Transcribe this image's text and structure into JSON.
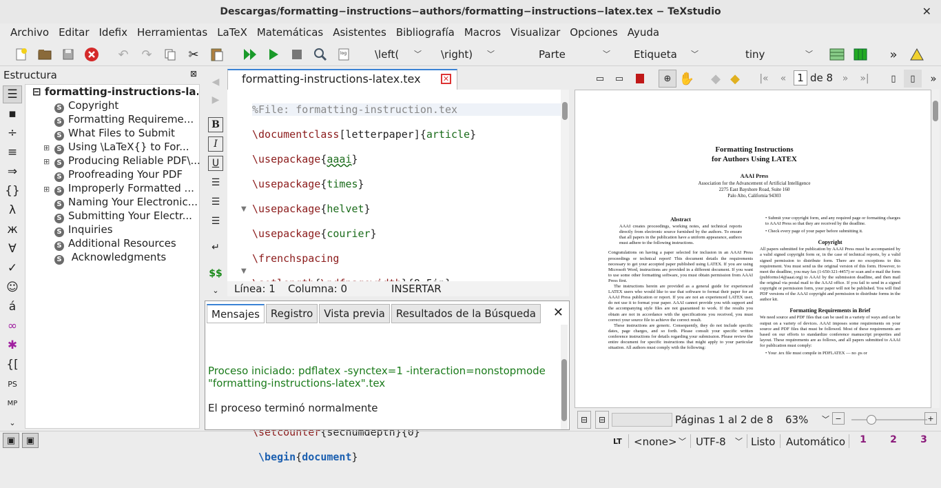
{
  "window": {
    "title": "Descargas/formatting−instructions−authors/formatting−instructions−latex.tex − TeXstudio",
    "close": "✕"
  },
  "menu": [
    "Archivo",
    "Editar",
    "Idefix",
    "Herramientas",
    "LaTeX",
    "Matemáticas",
    "Asistentes",
    "Bibliografía",
    "Macros",
    "Visualizar",
    "Opciones",
    "Ayuda"
  ],
  "toolbar": {
    "left_combo": "\\left(",
    "right_combo": "\\right)",
    "parte": "Parte",
    "etiqueta": "Etiqueta",
    "size": "tiny",
    "more": "»"
  },
  "structure": {
    "title": "Estructura",
    "root": "formatting-instructions-la...",
    "items": [
      {
        "label": "Copyright",
        "expandable": false
      },
      {
        "label": "Formatting Requireme...",
        "expandable": false
      },
      {
        "label": "What Files to Submit",
        "expandable": false
      },
      {
        "label": "Using \\LaTeX{} to For...",
        "expandable": true
      },
      {
        "label": "Producing Reliable PDF\\...",
        "expandable": true
      },
      {
        "label": "Proofreading Your PDF",
        "expandable": false
      },
      {
        "label": "Improperly Formatted ...",
        "expandable": true
      },
      {
        "label": "Naming Your Electronic...",
        "expandable": false
      },
      {
        "label": "Submitting Your Electr...",
        "expandable": false
      },
      {
        "label": "Inquiries",
        "expandable": false
      },
      {
        "label": "Additional Resources",
        "expandable": false
      },
      {
        "label": " Acknowledgments",
        "expandable": false
      }
    ]
  },
  "editor": {
    "tab": "formatting-instructions-latex.tex",
    "status": {
      "line": "Línea: 1",
      "col": "Columna: 0",
      "mode": "INSERTAR"
    }
  },
  "messages": {
    "tabs": [
      "Mensajes",
      "Registro",
      "Vista previa",
      "Resultados de la Búsqueda"
    ],
    "line1": "Proceso iniciado: pdflatex -synctex=1 -interaction=nonstopmode",
    "line2": "\"formatting-instructions-latex\".tex",
    "line3": "El proceso terminó normalmente"
  },
  "pdf": {
    "page_input": "1",
    "of": "de 8",
    "pages_label": "Páginas 1 al 2 de 8",
    "zoom": "63%",
    "title1": "Formatting Instructions",
    "title2": "for Authors Using LATEX",
    "press": "AAAI Press",
    "assoc": "Association for the Advancement of Artificial Intelligence",
    "addr1": "2275 East Bayshore Road, Suite 160",
    "addr2": "Palo Alto, California 94303",
    "abstract_h": "Abstract",
    "abstract": "AAAI creates proceedings, working notes, and technical reports directly from electronic source furnished by the authors. To ensure that all papers in the publication have a uniform appearance, authors must adhere to the following instructions.",
    "left1": "Congratulations on having a paper selected for inclusion in an AAAI Press proceedings or technical report! This document details the requirements necessary to get your accepted paper published using LATEX. If you are using Microsoft Word, instructions are provided in a different document. If you want to use some other formatting software, you must obtain permission from AAAI Press first.",
    "left2": "The instructions herein are provided as a general guide for experienced LATEX users who would like to use that software to format their paper for an AAAI Press publication or report. If you are not an experienced LATEX user, do not use it to format your paper. AAAI cannot provide you with support and the accompanying style files are not guaranteed to work. If the results you obtain are not in accordance with the specifications you received, you must correct your source file to achieve the correct result.",
    "left3": "These instructions are generic. Consequently, they do not include specific dates, page charges, and so forth. Please consult your specific written conference instructions for details regarding your submission. Please review the entire document for specific instructions that might apply to your particular situation. All authors must comply with the following:",
    "bullet1": "Submit your copyright form, and any required page or formatting charges to AAAI Press so that they are received by the deadline.",
    "bullet2": "Check every page of your paper before submitting it.",
    "copyright_h": "Copyright",
    "copyright": "All papers submitted for publication by AAAI Press must be accompanied by a valid signed copyright form or, in the case of technical reports, by a valid signed permission to distribute form. There are no exceptions to this requirement. You must send us the original version of this form. However, to meet the deadline, you may fax (1-650-321-4457) or scan and e-mail the form (pubforms14@aaai.org) to AAAI by the submission deadline, and then mail the original via postal mail to the AAAI office. If you fail to send in a signed copyright or permission form, your paper will not be published. You will find PDF versions of the AAAI copyright and permission to distribute forms in the author kit.",
    "brief_h": "Formatting Requirements in Brief",
    "brief": "We need source and PDF files that can be used in a variety of ways and can be output on a variety of devices. AAAI imposes some requirements on your source and PDF files that must be followed. Most of these requirements are based on our efforts to standardize conference manuscript properties and layout. These requirements are as follows, and all papers submitted to AAAI for publication must comply:",
    "bullet3": "Your .tex file must compile in PDFLATEX — no .ps or"
  },
  "bottom": {
    "lang": "<none>",
    "encoding": "UTF-8",
    "ready": "Listo",
    "auto": "Automático"
  }
}
